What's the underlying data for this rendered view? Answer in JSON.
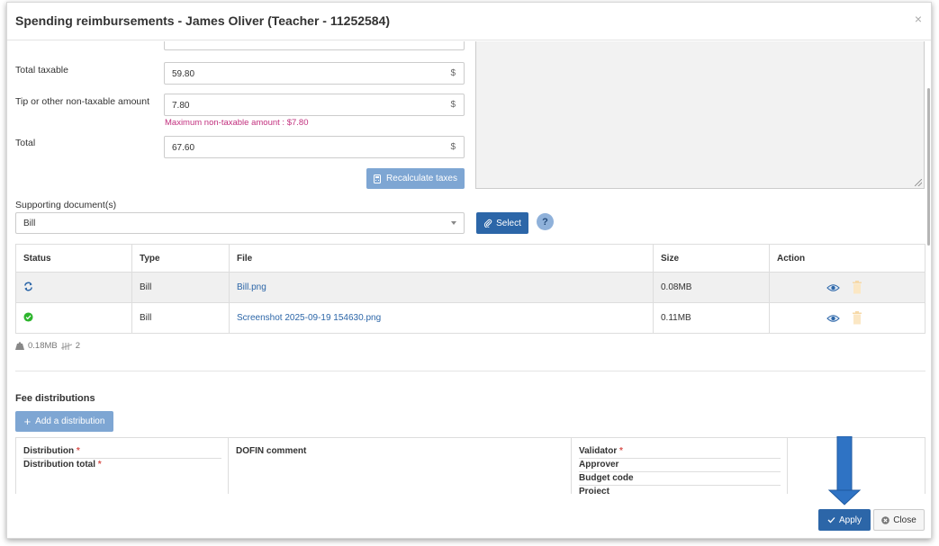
{
  "modal": {
    "title": "Spending reimbursements - James Oliver (Teacher - 11252584)",
    "close_x": "×"
  },
  "form": {
    "total_taxable": {
      "label": "Total taxable",
      "value": "59.80",
      "currency": "$"
    },
    "tip_amount": {
      "label": "Tip or other non-taxable amount",
      "value": "7.80",
      "currency": "$",
      "hint": "Maximum non-taxable amount : $7.80"
    },
    "total": {
      "label": "Total",
      "value": "67.60",
      "currency": "$"
    },
    "recalculate_label": "Recalculate taxes",
    "supporting_docs_label": "Supporting document(s)",
    "doc_type_selected": "Bill",
    "select_label": "Select",
    "help_label": "?"
  },
  "documents_table": {
    "columns": [
      "Status",
      "Type",
      "File",
      "Size",
      "Action"
    ],
    "rows": [
      {
        "status": "processing",
        "type": "Bill",
        "file": "Bill.png",
        "size": "0.08MB"
      },
      {
        "status": "done",
        "type": "Bill",
        "file": "Screenshot 2025-09-19 154630.png",
        "size": "0.11MB"
      }
    ]
  },
  "summary": {
    "total_size": "0.18MB",
    "file_count": "2"
  },
  "fee_distributions": {
    "title": "Fee distributions",
    "add_label": "Add a distribution",
    "distribution_label": "Distribution",
    "distribution_total_label": "Distribution total",
    "required_mark": "*",
    "dofin_comment_label": "DOFIN comment",
    "validator_label": "Validator",
    "approver_label": "Approver",
    "budget_code_label": "Budget code",
    "project_label": "Project"
  },
  "footer": {
    "apply_label": "Apply",
    "close_label": "Close"
  },
  "colors": {
    "primary": "#2c66a8",
    "primary_light": "#7ea6d3",
    "hint": "#c2307e",
    "success": "#2db52d",
    "arrow": "#2f73c4"
  }
}
